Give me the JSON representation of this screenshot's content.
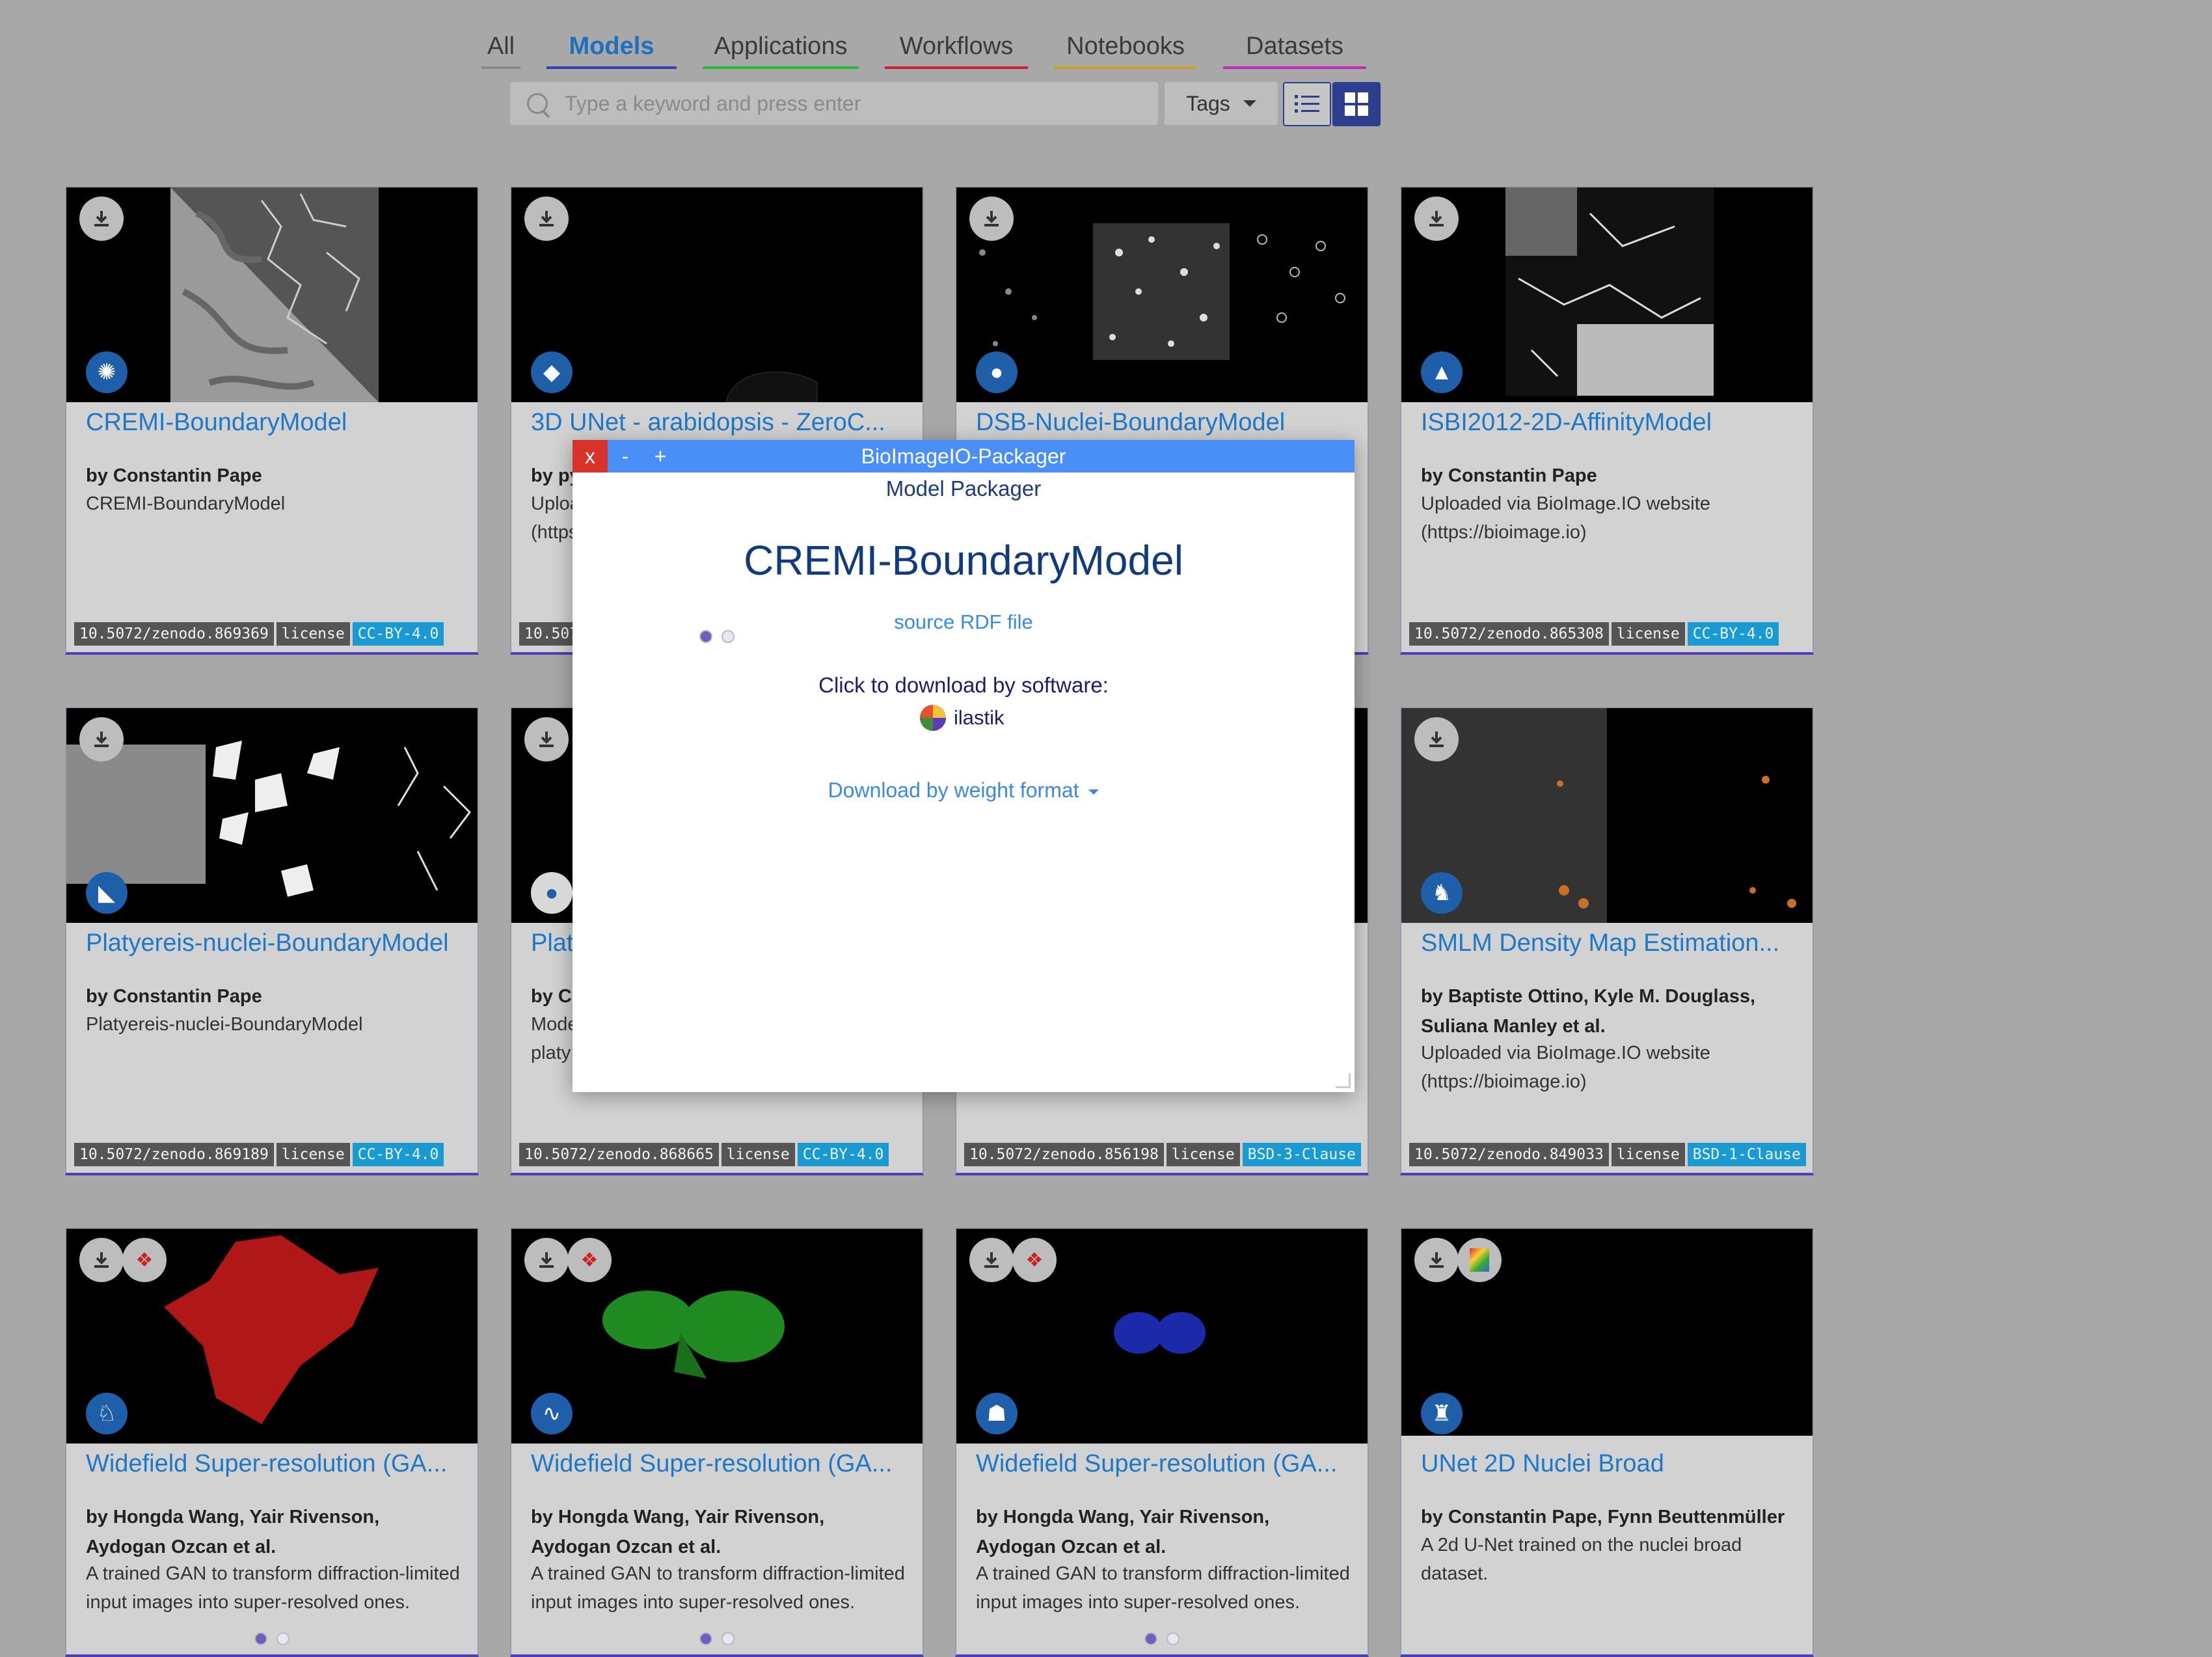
{
  "tabs": [
    {
      "label": "All",
      "color": "#888888",
      "active": false
    },
    {
      "label": "Models",
      "color": "#3b3fb5",
      "active": true
    },
    {
      "label": "Applications",
      "color": "#2fb83a",
      "active": false
    },
    {
      "label": "Workflows",
      "color": "#c9232c",
      "active": false
    },
    {
      "label": "Notebooks",
      "color": "#c9a227",
      "active": false
    },
    {
      "label": "Datasets",
      "color": "#c229b8",
      "active": false
    }
  ],
  "search": {
    "placeholder": "Type a keyword and press enter"
  },
  "tags_button": {
    "label": "Tags"
  },
  "cards": [
    {
      "title": "CREMI-BoundaryModel",
      "author": "by Constantin Pape",
      "desc": "CREMI-BoundaryModel",
      "doi": "10.5072/zenodo.869369",
      "license_label": "license",
      "license": "CC-BY-4.0",
      "avatar": "scorpion-icon"
    },
    {
      "title": "3D UNet - arabidopsis - ZeroC...",
      "author": "by py",
      "desc": "Uploa (https",
      "doi": "10.507",
      "license_label": "",
      "license": "",
      "avatar": "fish-icon"
    },
    {
      "title": "DSB-Nuclei-BoundaryModel",
      "author": "",
      "desc": "",
      "doi": "",
      "license_label": "",
      "license": "",
      "avatar": "elephant-icon"
    },
    {
      "title": "ISBI2012-2D-AffinityModel",
      "author": "by Constantin Pape",
      "desc": "Uploaded via BioImage.IO website (https://bioimage.io)",
      "doi": "10.5072/zenodo.865308",
      "license_label": "license",
      "license": "CC-BY-4.0",
      "avatar": "bird-icon"
    },
    {
      "title": "Platyereis-nuclei-BoundaryModel",
      "author": "by Constantin Pape",
      "desc": "Platyereis-nuclei-BoundaryModel",
      "doi": "10.5072/zenodo.869189",
      "license_label": "license",
      "license": "CC-BY-4.0",
      "avatar": "boot-icon"
    },
    {
      "title": "Plat",
      "author": "by C",
      "desc": "Mode platy",
      "doi": "10.5072/zenodo.868665",
      "license_label": "license",
      "license": "CC-BY-4.0",
      "avatar": "bear-icon"
    },
    {
      "title": "",
      "author": "",
      "desc": "",
      "doi": "10.5072/zenodo.856198",
      "license_label": "license",
      "license": "BSD-3-Clause",
      "avatar": ""
    },
    {
      "title": "SMLM Density Map Estimation...",
      "author": "by Baptiste Ottino, Kyle M. Douglass, Suliana Manley et al.",
      "desc": "Uploaded via BioImage.IO website (https://bioimage.io)",
      "doi": "10.5072/zenodo.849033",
      "license_label": "license",
      "license": "BSD-1-Clause",
      "avatar": "rabbit-icon"
    },
    {
      "title": "Widefield Super-resolution (GA...",
      "author": "by Hongda Wang, Yair Rivenson, Aydogan Ozcan et al.",
      "desc": "A trained GAN to transform diffraction-limited input images into super-resolved ones.",
      "doi": "",
      "license_label": "",
      "license": "",
      "avatar": "llama-icon"
    },
    {
      "title": "Widefield Super-resolution (GA...",
      "author": "by Hongda Wang, Yair Rivenson, Aydogan Ozcan et al.",
      "desc": "A trained GAN to transform diffraction-limited input images into super-resolved ones.",
      "doi": "",
      "license_label": "",
      "license": "",
      "avatar": "worm-icon"
    },
    {
      "title": "Widefield Super-resolution (GA...",
      "author": "by Hongda Wang, Yair Rivenson, Aydogan Ozcan et al.",
      "desc": "A trained GAN to transform diffraction-limited input images into super-resolved ones.",
      "doi": "",
      "license_label": "",
      "license": "",
      "avatar": "cat-icon"
    },
    {
      "title": "UNet 2D Nuclei Broad",
      "author": "by Constantin Pape, Fynn Beuttenmüller",
      "desc": "A 2d U-Net trained on the nuclei broad dataset.",
      "doi": "",
      "license_label": "",
      "license": "",
      "avatar": "fox-icon"
    }
  ],
  "modal": {
    "window_title": "BioImageIO-Packager",
    "close": "x",
    "minimize": "-",
    "maximize": "+",
    "subtitle": "Model Packager",
    "model_name": "CREMI-BoundaryModel",
    "rdf_link": "source RDF file",
    "click_label": "Click to download by software:",
    "software": "ilastik",
    "weight_format": "Download by weight format"
  }
}
